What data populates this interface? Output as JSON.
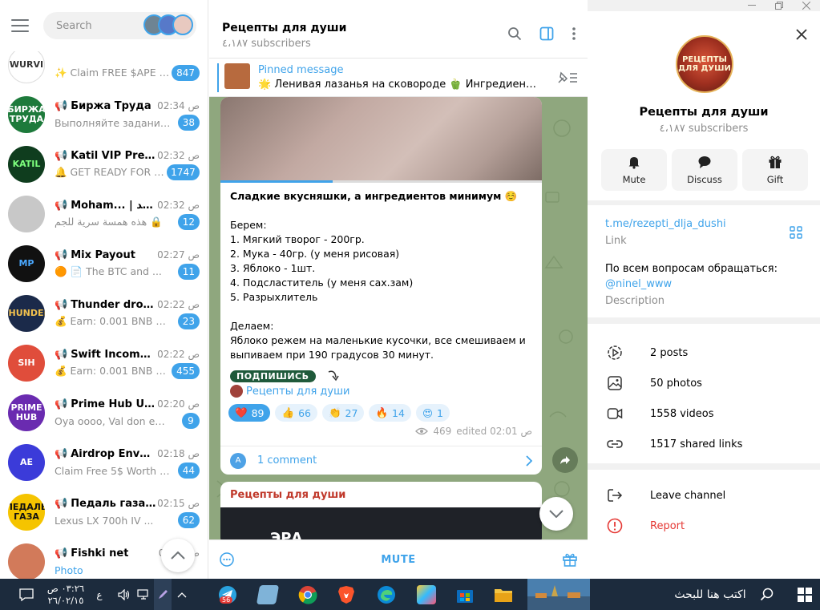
{
  "sidebar": {
    "search_placeholder": "Search",
    "chats": [
      {
        "name": "",
        "mega": false,
        "time": "",
        "message": "✨ Claim FREE $APE To...",
        "unread": "847",
        "avatar_label": "WURVI",
        "avatar_color": "#ffffff",
        "avatar_fg": "#333333"
      },
      {
        "name": "Биржа Труда",
        "mega": true,
        "time": "02:34 ص",
        "message": "Выполняйте задания и ...",
        "unread": "38",
        "avatar_label": "БИРЖА ТРУДА",
        "avatar_color": "#1d7a3b",
        "avatar_fg": "#ffffff"
      },
      {
        "name": "Katil VIP Pred...",
        "mega": true,
        "time": "02:32 ص",
        "message": "🔔 GET READY FOR LI...",
        "unread": "1747",
        "avatar_label": "KATIL",
        "avatar_color": "#0f3d1e",
        "avatar_fg": "#7dff7d"
      },
      {
        "name": "Moham... | مُحمد",
        "mega": true,
        "time": "02:32 ص",
        "message": "هذه همسة سرية للجم 🔒",
        "unread": "12",
        "avatar_label": "",
        "avatar_color": "#c8c8c8",
        "avatar_fg": "#ffffff"
      },
      {
        "name": "Mix Payout",
        "mega": true,
        "time": "02:27 ص",
        "message": "🟠 📄 The BTC and ...",
        "unread": "11",
        "avatar_label": "MP",
        "avatar_color": "#111111",
        "avatar_fg": "#4aa8ff"
      },
      {
        "name": "Thunder drop...",
        "mega": true,
        "time": "02:22 ص",
        "message": "💰 Earn: 0.001 BNB per ...",
        "unread": "23",
        "avatar_label": "THUNDER",
        "avatar_color": "#1b2a4a",
        "avatar_fg": "#f2c14e"
      },
      {
        "name": "Swift Income hub",
        "mega": true,
        "time": "02:22 ص",
        "message": "💰 Earn: 0.001 BNB pe...",
        "unread": "455",
        "avatar_label": "SIH",
        "avatar_color": "#e04d3b",
        "avatar_fg": "#ffffff"
      },
      {
        "name": "Prime Hub Up...",
        "mega": true,
        "time": "02:20 ص",
        "message": "Oya oooo, Val don end ...",
        "unread": "9",
        "avatar_label": "PRIME HUB",
        "avatar_color": "#6a2bb0",
        "avatar_fg": "#ffffff"
      },
      {
        "name": "Airdrop Envoy™",
        "mega": true,
        "time": "02:18 ص",
        "message": "Claim Free 5$ Worth ST...",
        "unread": "44",
        "avatar_label": "AE",
        "avatar_color": "#3b3bd9",
        "avatar_fg": "#ffffff"
      },
      {
        "name": "Педаль газа | ...",
        "mega": true,
        "time": "02:15 ص",
        "message": "Lexus LX 700h IV ...",
        "unread": "62",
        "avatar_label": "ПЕДАЛЬ ГАЗА",
        "avatar_color": "#f5c400",
        "avatar_fg": "#111111"
      },
      {
        "name": "Fishki net",
        "mega": true,
        "time": "02:1_ ص",
        "message": "Photo",
        "unread": "",
        "avatar_label": "",
        "avatar_color": "#d27a5a",
        "avatar_fg": "#ffffff"
      }
    ]
  },
  "chat": {
    "title": "Рецепты для души",
    "subscribers": "٤،١٨٧ subscribers",
    "pinned": {
      "label": "Pinned message",
      "text": "🌟 Ленивая лазанья на сковороде 🫑 Ингредиенты: ..."
    },
    "post": {
      "video_progress_pct": 35,
      "headline": "Сладкие вкусняшки, а ингредиентов минимум ☺️",
      "body": "Берем:\n1. Мягкий творог - 200гр.\n2. Мука - 40гр. (у меня рисовая)\n3. Яблоко - 1шт.\n4. Подсластитель (у меня сах.зам)\n5. Разрыхлитель\n\nДелаем:\nЯблоко режем на маленькие кусочки, все смешиваем и выпиваем при 190 градусов 30 минут.",
      "subscribe_chip": "ПОДПИШИСЬ",
      "channel_link": "Рецепты для души",
      "reactions": [
        {
          "emoji": "❤️",
          "count": "89",
          "active": true
        },
        {
          "emoji": "👍",
          "count": "66",
          "active": false
        },
        {
          "emoji": "👏",
          "count": "27",
          "active": false
        },
        {
          "emoji": "🔥",
          "count": "14",
          "active": false
        },
        {
          "emoji": "😍",
          "count": "1",
          "active": false
        }
      ],
      "views": "469",
      "edited": "edited 02:01 ص",
      "comments_avatar": "A",
      "comments": "1 comment"
    },
    "next_post": {
      "author": "Рецепты для души",
      "media_logo": "ЭРА"
    },
    "footer": {
      "mute_label": "MUTE"
    }
  },
  "info": {
    "avatar_label": "РЕЦЕПТЫ ДЛЯ ДУШИ",
    "name": "Рецепты для души",
    "subscribers": "٤،١٨٧ subscribers",
    "actions": [
      {
        "label": "Mute",
        "icon": "bell-icon"
      },
      {
        "label": "Discuss",
        "icon": "chat-bubble-icon"
      },
      {
        "label": "Gift",
        "icon": "gift-icon"
      }
    ],
    "link": "t.me/rezepti_dlja_dushi",
    "link_caption": "Link",
    "description": "По всем вопросам обращаться:",
    "description_handle": "@ninel_www",
    "description_caption": "Description",
    "stats": [
      {
        "label": "2 posts",
        "icon": "posts-icon"
      },
      {
        "label": "50 photos",
        "icon": "photo-icon"
      },
      {
        "label": "1558 videos",
        "icon": "video-icon"
      },
      {
        "label": "1517 shared links",
        "icon": "link-icon"
      }
    ],
    "leave_label": "Leave channel",
    "report_label": "Report"
  },
  "taskbar": {
    "time": "٠٣:٢٦ ص",
    "date": "٢٦/٠٢/١٥",
    "lang": "ع",
    "telegram_badge": "56",
    "search_text": "اكتب هنا للبحث"
  },
  "colors": {
    "accent": "#3fa3ea",
    "report": "#e53935",
    "chat_bg": "#8fa77e",
    "taskbar": "#1c2b3d"
  }
}
